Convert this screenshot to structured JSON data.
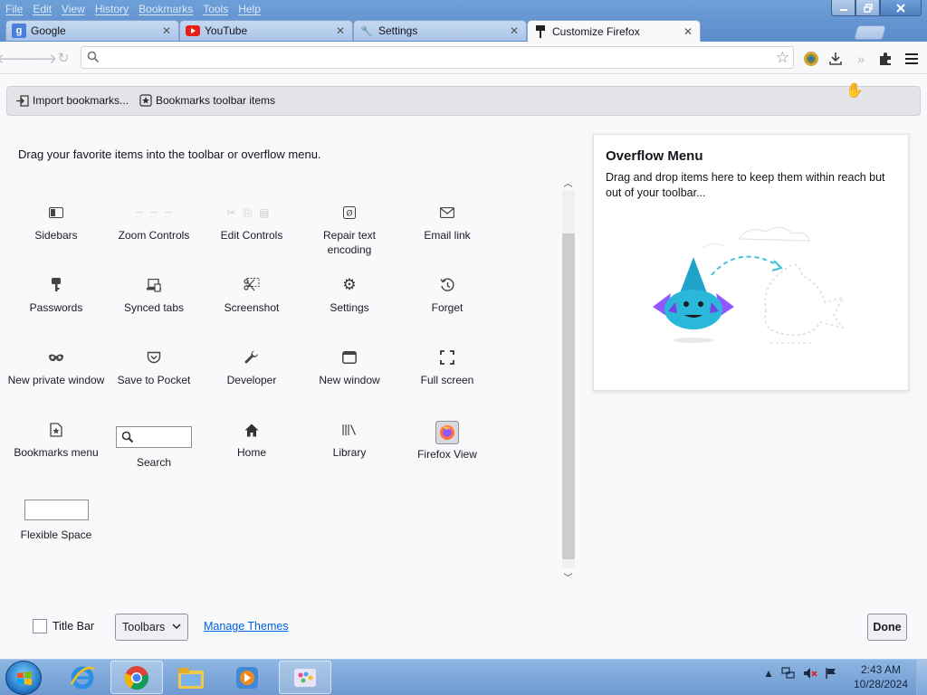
{
  "menubar": {
    "items": [
      "File",
      "Edit",
      "View",
      "History",
      "Bookmarks",
      "Tools",
      "Help"
    ]
  },
  "tabs": [
    {
      "label": "Google",
      "icon": "google-icon",
      "active": false
    },
    {
      "label": "YouTube",
      "icon": "youtube-icon",
      "active": false
    },
    {
      "label": "Settings",
      "icon": "wrench-icon",
      "active": false
    },
    {
      "label": "Customize Firefox",
      "icon": "paintbrush-icon",
      "active": true
    }
  ],
  "navbar": {
    "url_value": "",
    "url_placeholder": ""
  },
  "bookmarks_toolbar": {
    "import_label": "Import bookmarks...",
    "items_label": "Bookmarks toolbar items"
  },
  "palette": {
    "instructions": "Drag your favorite items into the toolbar or overflow menu.",
    "items": [
      {
        "label": "Sidebars",
        "icon": "sidebars-icon"
      },
      {
        "label": "Zoom Controls",
        "icon": "zoom-controls-icon"
      },
      {
        "label": "Edit Controls",
        "icon": "edit-controls-icon"
      },
      {
        "label": "Repair text encoding",
        "icon": "text-encoding-icon"
      },
      {
        "label": "Email link",
        "icon": "email-icon"
      },
      {
        "label": "Passwords",
        "icon": "key-icon"
      },
      {
        "label": "Synced tabs",
        "icon": "synced-tabs-icon"
      },
      {
        "label": "Screenshot",
        "icon": "screenshot-icon"
      },
      {
        "label": "Settings",
        "icon": "gear-icon"
      },
      {
        "label": "Forget",
        "icon": "forget-icon"
      },
      {
        "label": "New private window",
        "icon": "private-window-icon"
      },
      {
        "label": "Save to Pocket",
        "icon": "pocket-icon"
      },
      {
        "label": "Developer",
        "icon": "wrench-icon"
      },
      {
        "label": "New window",
        "icon": "new-window-icon"
      },
      {
        "label": "Full screen",
        "icon": "fullscreen-icon"
      },
      {
        "label": "Bookmarks menu",
        "icon": "bookmarks-menu-icon"
      },
      {
        "label": "Search",
        "icon": "search-icon"
      },
      {
        "label": "Home",
        "icon": "home-icon"
      },
      {
        "label": "Library",
        "icon": "library-icon"
      },
      {
        "label": "Firefox View",
        "icon": "firefox-view-icon"
      },
      {
        "label": "Flexible Space",
        "icon": ""
      }
    ]
  },
  "overflow": {
    "title": "Overflow Menu",
    "description": "Drag and drop items here to keep them within reach but out of your toolbar..."
  },
  "footer": {
    "title_bar_label": "Title Bar",
    "title_bar_checked": false,
    "toolbars_label": "Toolbars",
    "manage_themes_label": "Manage Themes",
    "done_label": "Done"
  },
  "taskbar": {
    "clock_time": "2:43 AM",
    "clock_date": "10/28/2024"
  },
  "colors": {
    "accent_blue": "#0060df",
    "titlebar": "#6e9fd8",
    "taskbar": "#7ea6d8"
  }
}
